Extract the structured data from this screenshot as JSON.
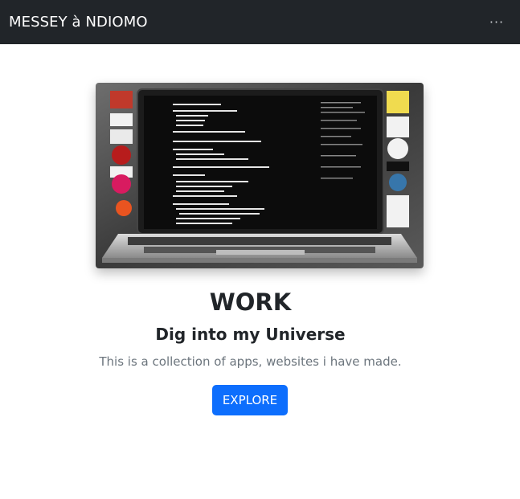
{
  "navbar": {
    "brand": "MESSEY à NDIOMO",
    "menu_icon": "more-dots-icon"
  },
  "hero": {
    "image_icon": "laptop-code-image",
    "title": "WORK",
    "subtitle": "Dig into my Universe",
    "description": "This is a collection of apps, websites i have made.",
    "cta_label": "EXPLORE"
  },
  "colors": {
    "navbar_bg": "#212529",
    "primary": "#0d6efd",
    "muted_text": "#6c757d"
  }
}
